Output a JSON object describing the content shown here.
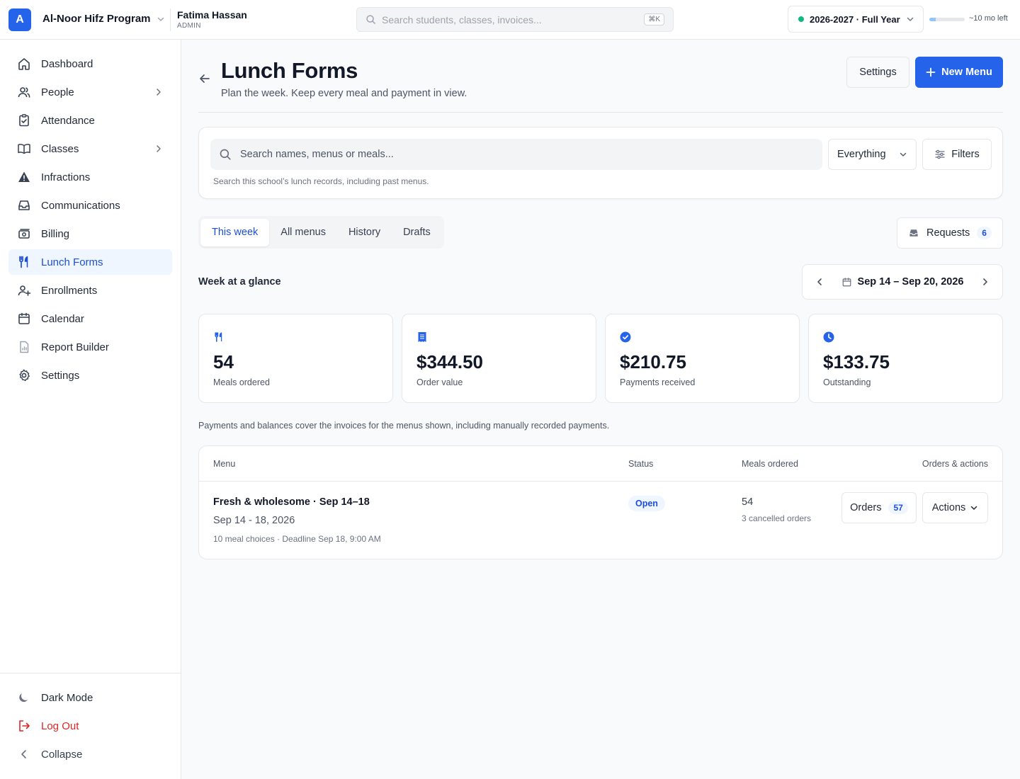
{
  "topbar": {
    "logo_letter": "A",
    "org_name": "Al-Noor Hifz Program",
    "user_name": "Fatima Hassan",
    "user_role": "ADMIN",
    "search_placeholder": "Search students, classes, invoices...",
    "search_shortcut": "⌘K",
    "school_year": "2026-2027 · Full Year",
    "year_remaining": "~10 mo left",
    "year_progress_fraction": 0.17,
    "status_color": "#10b981"
  },
  "sidebar": {
    "items": [
      {
        "label": "Dashboard",
        "icon": "home-icon"
      },
      {
        "label": "People",
        "icon": "people-icon"
      },
      {
        "label": "Attendance",
        "icon": "clipboard-check-icon"
      },
      {
        "label": "Classes",
        "icon": "book-icon"
      },
      {
        "label": "Infractions",
        "icon": "warning-icon"
      },
      {
        "label": "Communications",
        "icon": "inbox-icon"
      },
      {
        "label": "Billing",
        "icon": "money-icon"
      },
      {
        "label": "Lunch Forms",
        "icon": "utensils-icon"
      },
      {
        "label": "Enrollments",
        "icon": "user-plus-icon"
      },
      {
        "label": "Calendar",
        "icon": "calendar-icon"
      },
      {
        "label": "Report Builder",
        "icon": "report-icon"
      },
      {
        "label": "Settings",
        "icon": "gear-icon"
      }
    ],
    "active": "Lunch Forms",
    "bottom": {
      "dark_mode": "Dark Mode",
      "logout": "Log Out",
      "collapse": "Collapse"
    }
  },
  "page": {
    "title": "Lunch Forms",
    "subtitle": "Plan the week. Keep every meal and payment in view.",
    "settings_label": "Settings",
    "new_menu_label": "New Menu",
    "accent_color": "#2563eb"
  },
  "search": {
    "placeholder": "Search names, menus or meals...",
    "scope": "Everything",
    "filters_label": "Filters",
    "hint": "Search this school’s lunch records, including past menus."
  },
  "tabs": [
    {
      "label": "This week"
    },
    {
      "label": "All menus"
    },
    {
      "label": "History"
    },
    {
      "label": "Drafts"
    }
  ],
  "active_tab": "This week",
  "requests": {
    "label": "Requests",
    "count": "6"
  },
  "glance": {
    "label": "Week at a glance",
    "week_range": "Sep 14 – Sep 20, 2026"
  },
  "stats": [
    {
      "value": "54",
      "label": "Meals ordered",
      "icon": "utensils-icon"
    },
    {
      "value": "$344.50",
      "label": "Order value",
      "icon": "receipt-icon"
    },
    {
      "value": "$210.75",
      "label": "Payments received",
      "icon": "check-circle-icon"
    },
    {
      "value": "$133.75",
      "label": "Outstanding",
      "icon": "clock-icon"
    }
  ],
  "note": "Payments and balances cover the invoices for the menus shown, including manually recorded payments.",
  "table": {
    "headers": {
      "menu": "Menu",
      "status": "Status",
      "meals": "Meals ordered",
      "actions": "Orders & actions"
    },
    "rows": [
      {
        "name": "Fresh & wholesome · Sep 14–18",
        "dates": "Sep 14 - 18, 2026",
        "meta": "10 meal choices · Deadline Sep 18, 9:00 AM",
        "status": "Open",
        "meals": "54",
        "cancelled": "3 cancelled orders",
        "orders_label": "Orders",
        "orders_count": "57",
        "actions_label": "Actions"
      }
    ]
  }
}
